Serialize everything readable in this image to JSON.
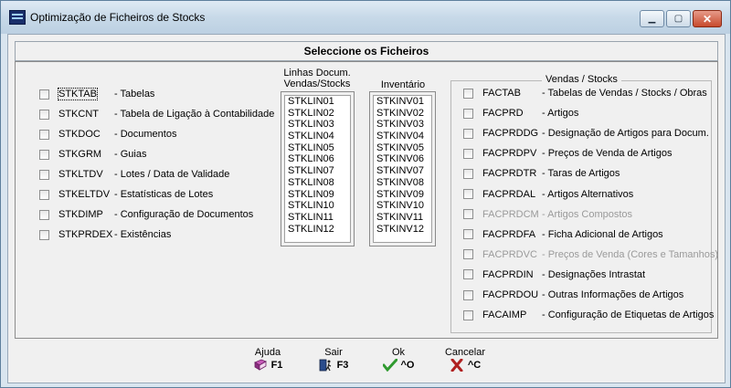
{
  "window": {
    "title": "Optimização de Ficheiros de Stocks",
    "controls": {
      "minimize": "▁",
      "maximize": "▢",
      "close": "✕"
    }
  },
  "header": {
    "title": "Seleccione os Ficheiros"
  },
  "left_files": [
    {
      "code": "STKTAB",
      "desc": "- Tabelas",
      "checked": false,
      "focused": true
    },
    {
      "code": "STKCNT",
      "desc": "- Tabela de Ligação à Contabilidade",
      "checked": false
    },
    {
      "code": "STKDOC",
      "desc": "- Documentos",
      "checked": false
    },
    {
      "code": "STKGRM",
      "desc": "- Guias",
      "checked": false
    },
    {
      "code": "STKLTDV",
      "desc": "- Lotes / Data de Validade",
      "checked": false
    },
    {
      "code": "STKELTDV",
      "desc": "- Estatísticas de Lotes",
      "checked": false
    },
    {
      "code": "STKDIMP",
      "desc": "- Configuração de Documentos",
      "checked": false
    },
    {
      "code": "STKPRDEX",
      "desc": "- Existências",
      "checked": false
    }
  ],
  "linhas": {
    "title_line1": "Linhas Docum.",
    "title_line2": "Vendas/Stocks",
    "items": [
      "STKLIN01",
      "STKLIN02",
      "STKLIN03",
      "STKLIN04",
      "STKLIN05",
      "STKLIN06",
      "STKLIN07",
      "STKLIN08",
      "STKLIN09",
      "STKLIN10",
      "STKLIN11",
      "STKLIN12"
    ]
  },
  "inventario": {
    "title": "Inventário",
    "items": [
      "STKINV01",
      "STKINV02",
      "STKINV03",
      "STKINV04",
      "STKINV05",
      "STKINV06",
      "STKINV07",
      "STKINV08",
      "STKINV09",
      "STKINV10",
      "STKINV11",
      "STKINV12"
    ]
  },
  "vendas_stocks": {
    "legend": "Vendas / Stocks",
    "items": [
      {
        "code": "FACTAB",
        "desc": "- Tabelas de Vendas / Stocks / Obras",
        "enabled": true
      },
      {
        "code": "FACPRD",
        "desc": "- Artigos",
        "enabled": true
      },
      {
        "code": "FACPRDDG",
        "desc": "- Designação de Artigos para Docum.",
        "enabled": true
      },
      {
        "code": "FACPRDPV",
        "desc": "- Preços de Venda de Artigos",
        "enabled": true
      },
      {
        "code": "FACPRDTR",
        "desc": "- Taras de Artigos",
        "enabled": true
      },
      {
        "code": "FACPRDAL",
        "desc": "- Artigos Alternativos",
        "enabled": true
      },
      {
        "code": "FACPRDCM",
        "desc": "- Artigos Compostos",
        "enabled": false
      },
      {
        "code": "FACPRDFA",
        "desc": "- Ficha Adicional de Artigos",
        "enabled": true
      },
      {
        "code": "FACPRDVC",
        "desc": "- Preços de Venda (Cores e Tamanhos)",
        "enabled": false
      },
      {
        "code": "FACPRDIN",
        "desc": "- Designações Intrastat",
        "enabled": true
      },
      {
        "code": "FACPRDOU",
        "desc": "- Outras Informações de Artigos",
        "enabled": true
      },
      {
        "code": "FACAIMP",
        "desc": "- Configuração de Etiquetas de Artigos",
        "enabled": true
      }
    ]
  },
  "footer": {
    "ajuda": {
      "label": "Ajuda",
      "key": "F1",
      "icon": "book-icon"
    },
    "sair": {
      "label": "Sair",
      "key": "F3",
      "icon": "exit-door-icon"
    },
    "ok": {
      "label": "Ok",
      "key": "^O",
      "icon": "check-icon"
    },
    "cancelar": {
      "label": "Cancelar",
      "key": "^C",
      "icon": "cross-icon"
    }
  },
  "colors": {
    "titlebar": "#c7d9e8",
    "client": "#f0f0f0",
    "disabled_text": "#9a9a9a",
    "ok_green": "#2f9a2f",
    "cancel_red": "#b02020"
  }
}
